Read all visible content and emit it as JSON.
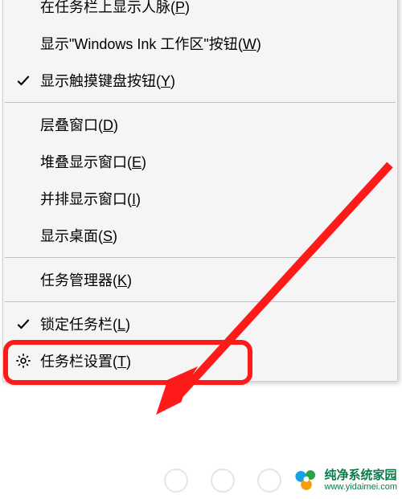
{
  "menu": {
    "section1": [
      {
        "label": "在任务栏上显示人脉",
        "accel": "P",
        "checked": false,
        "icon": null
      },
      {
        "label": "显示\"Windows Ink 工作区\"按钮",
        "accel": "W",
        "checked": false,
        "icon": null
      },
      {
        "label": "显示触摸键盘按钮",
        "accel": "Y",
        "checked": true,
        "icon": null
      }
    ],
    "section2": [
      {
        "label": "层叠窗口",
        "accel": "D",
        "checked": false,
        "icon": null
      },
      {
        "label": "堆叠显示窗口",
        "accel": "E",
        "checked": false,
        "icon": null
      },
      {
        "label": "并排显示窗口",
        "accel": "I",
        "checked": false,
        "icon": null
      },
      {
        "label": "显示桌面",
        "accel": "S",
        "checked": false,
        "icon": null
      }
    ],
    "section3": [
      {
        "label": "任务管理器",
        "accel": "K",
        "checked": false,
        "icon": null
      }
    ],
    "section4": [
      {
        "label": "锁定任务栏",
        "accel": "L",
        "checked": true,
        "icon": null
      },
      {
        "label": "任务栏设置",
        "accel": "T",
        "checked": false,
        "icon": "gear"
      }
    ]
  },
  "watermark": {
    "title": "纯净系统家园",
    "url": "www.yidaimei.com"
  },
  "annotation": {
    "highlight_target": "任务栏设置",
    "highlight_color": "#ff1a1a"
  }
}
